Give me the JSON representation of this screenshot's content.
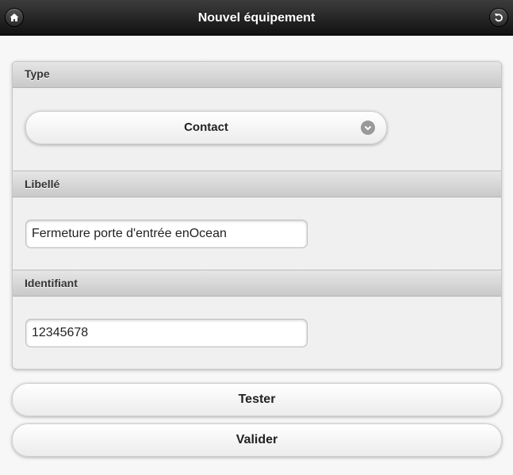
{
  "header": {
    "title": "Nouvel équipement",
    "left_icon": "home-icon",
    "right_icon": "back-icon"
  },
  "form": {
    "type_label": "Type",
    "type_value": "Contact",
    "libelle_label": "Libellé",
    "libelle_value": "Fermeture porte d'entrée enOcean",
    "identifiant_label": "Identifiant",
    "identifiant_value": "12345678"
  },
  "actions": {
    "tester_label": "Tester",
    "valider_label": "Valider"
  },
  "colors": {
    "header_bg": "#1a1a1a",
    "panel_bg": "#f0f0f0",
    "section_head_bg": "#d4d4d4"
  }
}
